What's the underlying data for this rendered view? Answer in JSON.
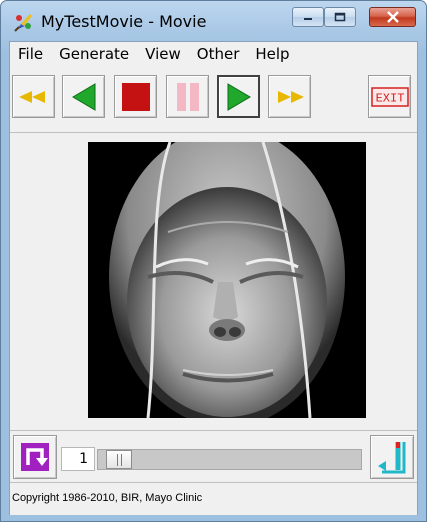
{
  "window": {
    "title": "MyTestMovie - Movie",
    "app_icon": "paint-palette-icon",
    "caption_buttons": [
      "minimize-icon",
      "maximize-icon",
      "close-icon"
    ]
  },
  "menu": {
    "items": [
      {
        "label": "File"
      },
      {
        "label": "Generate"
      },
      {
        "label": "View"
      },
      {
        "label": "Other"
      },
      {
        "label": "Help"
      }
    ]
  },
  "toolbar": {
    "buttons": [
      {
        "name": "rewind-to-start",
        "icon": "rewind-icon",
        "color": "#e8b800"
      },
      {
        "name": "play-backward",
        "icon": "play-reverse-icon",
        "color": "#1fa82c"
      },
      {
        "name": "stop",
        "icon": "stop-icon",
        "color": "#c41212"
      },
      {
        "name": "pause",
        "icon": "pause-icon",
        "color": "#f3b8c4"
      },
      {
        "name": "play-forward",
        "icon": "play-icon",
        "color": "#1fa82c",
        "active": true
      },
      {
        "name": "fast-forward",
        "icon": "fast-forward-icon",
        "color": "#e8b800"
      },
      {
        "name": "exit",
        "icon": "exit-icon",
        "label": "EXIT",
        "color": "#d42020"
      }
    ]
  },
  "viewer": {
    "content": "3d-rendered-face-image"
  },
  "controls": {
    "loop_icon": "loop-icon",
    "loop_color": "#a020c0",
    "frame_number": "1",
    "slider_level": 0,
    "bounce_icon": "bounce-icon",
    "bounce_color": "#20b8c8"
  },
  "status": {
    "text": "Copyright 1986-2010, BIR, Mayo Clinic"
  }
}
